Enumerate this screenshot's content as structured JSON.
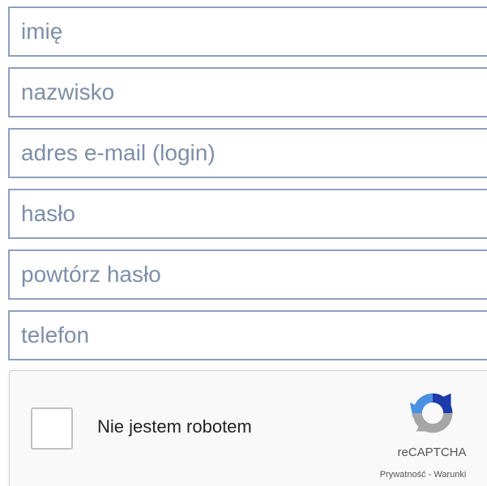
{
  "form": {
    "fields": [
      {
        "placeholder": "imię",
        "value": ""
      },
      {
        "placeholder": "nazwisko",
        "value": ""
      },
      {
        "placeholder": "adres e-mail (login)",
        "value": ""
      },
      {
        "placeholder": "hasło",
        "value": ""
      },
      {
        "placeholder": "powtórz hasło",
        "value": ""
      },
      {
        "placeholder": "telefon",
        "value": ""
      }
    ]
  },
  "recaptcha": {
    "label": "Nie jestem robotem",
    "brand": "reCAPTCHA",
    "privacy_label": "Prywatność",
    "separator": " - ",
    "terms_label": "Warunki",
    "checked": false,
    "logo_icon": "recaptcha-logo-icon"
  },
  "colors": {
    "field_border": "#8f9fbf",
    "placeholder": "#7f8ea9",
    "captcha_bg": "#f9f9f9",
    "captcha_blue": "#1c3aa9",
    "captcha_lightblue": "#4a90e2",
    "captcha_gray": "#a6a6a6"
  }
}
